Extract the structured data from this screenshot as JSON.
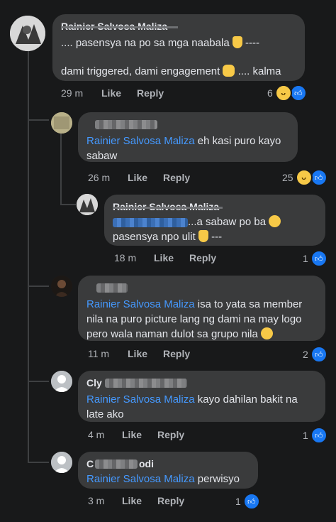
{
  "comments": [
    {
      "author": "Rainier Salvosa Maliza",
      "lines": [
        ".... pasensya na po sa mga naabala",
        " ----",
        "dami triggered, dami engagement",
        " .... kalma"
      ],
      "time": "29 m",
      "like": "Like",
      "reply": "Reply",
      "count": "6"
    },
    {
      "author": "",
      "mention": "Rainier Salvosa Maliza",
      "text": " eh kasi puro kayo sabaw",
      "time": "26 m",
      "like": "Like",
      "reply": "Reply",
      "count": "25"
    },
    {
      "author": "Rainier Salvosa Maliza",
      "text1": "...a sabaw po ba",
      "text2": "pasensya npo ulit",
      "text3": " ---",
      "time": "18 m",
      "like": "Like",
      "reply": "Reply",
      "count": "1"
    },
    {
      "author": "",
      "mention": "Rainier Salvosa Maliza",
      "text": " isa to yata sa member nila na puro picture lang ng dami na may logo pero wala naman dulot sa grupo nila",
      "time": "11 m",
      "like": "Like",
      "reply": "Reply",
      "count": "2"
    },
    {
      "author": "Cly",
      "mention": "Rainier Salvosa Maliza",
      "text": " kayo dahilan bakit na late ako",
      "time": "4 m",
      "like": "Like",
      "reply": "Reply",
      "count": "1"
    },
    {
      "author": "C",
      "author_tail": "odi",
      "mention": "Rainier Salvosa Maliza",
      "text": " perwisyo",
      "time": "3 m",
      "like": "Like",
      "reply": "Reply",
      "count": "1"
    }
  ],
  "colors": {
    "bubble": "#3a3b3c",
    "mention": "#4599ff",
    "like_blue": "#1877f2",
    "haha_yellow": "#f7c947"
  }
}
